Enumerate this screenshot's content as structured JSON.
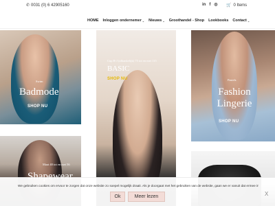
{
  "topbar": {
    "phone": "0031 (0) 6 42905160",
    "phone_icon": "phone-icon",
    "social": [
      "in",
      "f",
      "◎"
    ],
    "cart_label": "0 Items",
    "cart_icon": "cart-icon"
  },
  "nav": {
    "items": [
      {
        "label": "HOME",
        "has_dropdown": false
      },
      {
        "label": "Inloggen ondernemer",
        "has_dropdown": true
      },
      {
        "label": "Nieuws",
        "has_dropdown": true
      },
      {
        "label": "Groothandel - Shop",
        "has_dropdown": false
      },
      {
        "label": "Lookbooks",
        "has_dropdown": false
      },
      {
        "label": "Contact",
        "has_dropdown": true
      }
    ]
  },
  "tiles": {
    "badmode": {
      "small": "Swim",
      "title": "Badmode",
      "cta": "SHOP NU"
    },
    "basic": {
      "small": "Cup B-J (afhankelijk) 75 tot en met 115",
      "title": "BASIC",
      "cta": "SHOP NU"
    },
    "fashion": {
      "small": "Pastels",
      "title": "Fashion Lingerie",
      "cta": "SHOP NU"
    },
    "shapewear": {
      "small": "Maat 40 tot en met 56",
      "title": "Shapewear"
    }
  },
  "cookie": {
    "text": "We gebruiken cookies om ervoor te zorgen dat onze website zo soepel mogelijk draait. Als je doorgaat met het gebruiken van de website, gaan we er vanuit dat ermee instemt.",
    "ok_label": "Ok",
    "more_label": "Meer lezen",
    "close": "X"
  }
}
